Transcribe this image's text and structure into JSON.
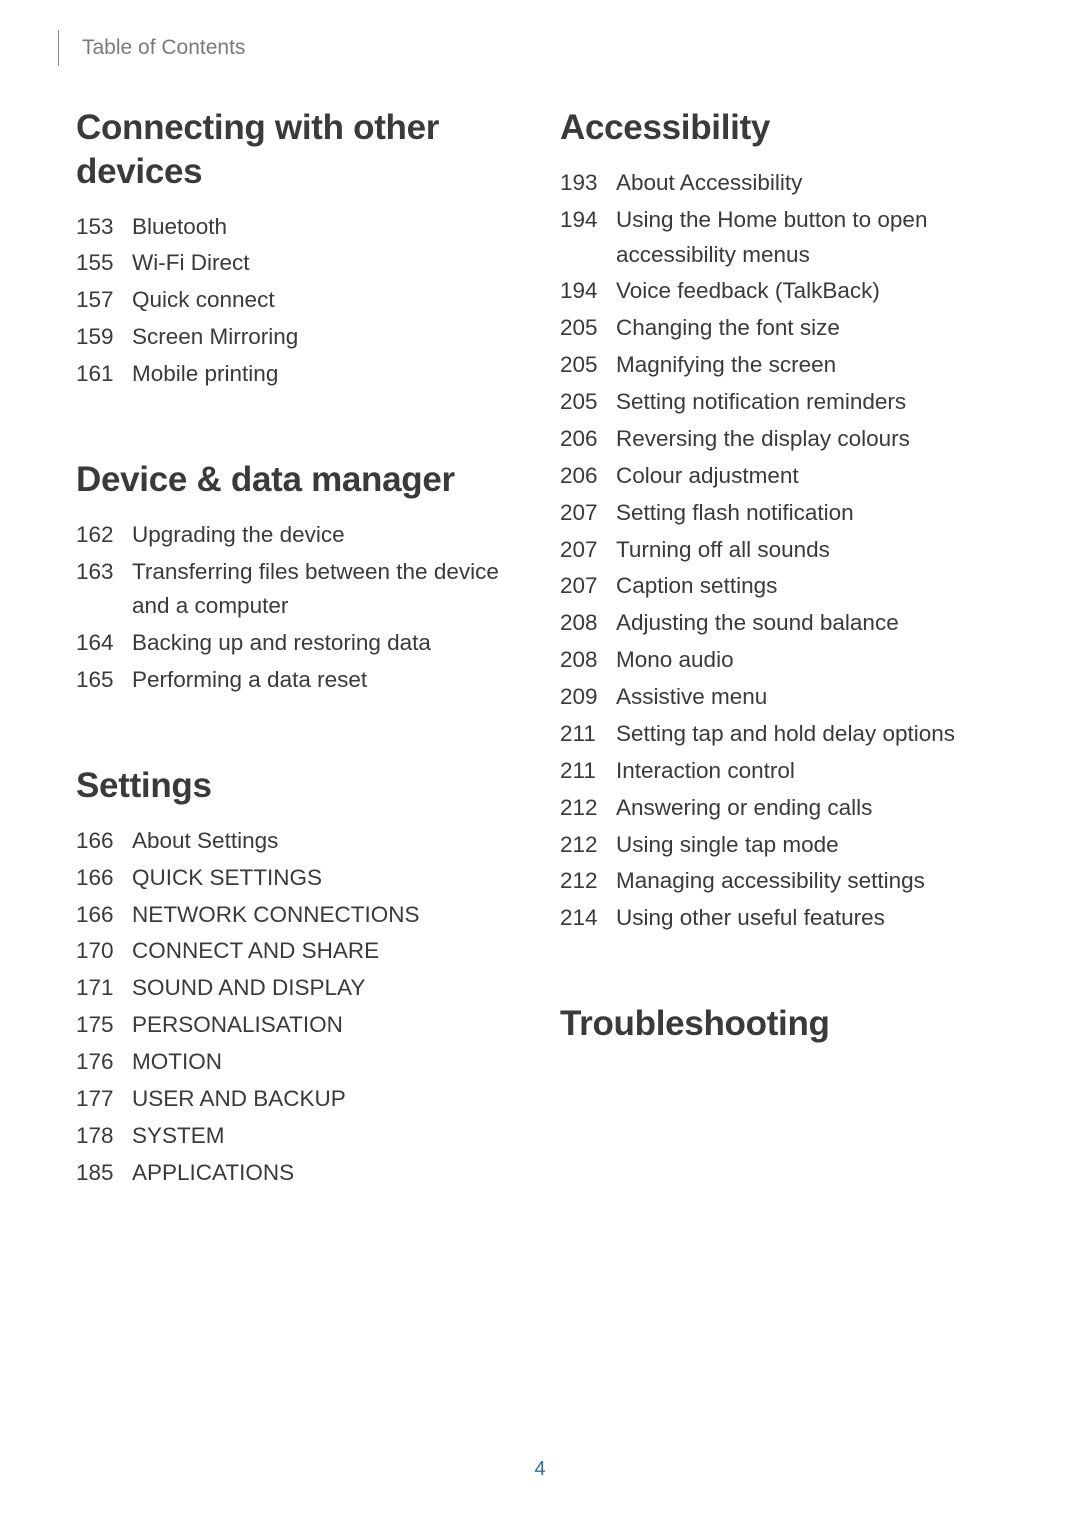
{
  "running_head": "Table of Contents",
  "page_number": "4",
  "left_column": [
    {
      "heading": "Connecting with other devices",
      "entries": [
        {
          "page": "153",
          "title": "Bluetooth"
        },
        {
          "page": "155",
          "title": "Wi-Fi Direct"
        },
        {
          "page": "157",
          "title": "Quick connect"
        },
        {
          "page": "159",
          "title": "Screen Mirroring"
        },
        {
          "page": "161",
          "title": "Mobile printing"
        }
      ]
    },
    {
      "heading": "Device & data manager",
      "entries": [
        {
          "page": "162",
          "title": "Upgrading the device"
        },
        {
          "page": "163",
          "title": "Transferring files between the device and a computer"
        },
        {
          "page": "164",
          "title": "Backing up and restoring data"
        },
        {
          "page": "165",
          "title": "Performing a data reset"
        }
      ]
    },
    {
      "heading": "Settings",
      "entries": [
        {
          "page": "166",
          "title": "About Settings"
        },
        {
          "page": "166",
          "title": "QUICK SETTINGS"
        },
        {
          "page": "166",
          "title": "NETWORK CONNECTIONS"
        },
        {
          "page": "170",
          "title": "CONNECT AND SHARE"
        },
        {
          "page": "171",
          "title": "SOUND AND DISPLAY"
        },
        {
          "page": "175",
          "title": "PERSONALISATION"
        },
        {
          "page": "176",
          "title": "MOTION"
        },
        {
          "page": "177",
          "title": "USER AND BACKUP"
        },
        {
          "page": "178",
          "title": "SYSTEM"
        },
        {
          "page": "185",
          "title": "APPLICATIONS"
        }
      ]
    }
  ],
  "right_column": [
    {
      "heading": "Accessibility",
      "entries": [
        {
          "page": "193",
          "title": "About Accessibility"
        },
        {
          "page": "194",
          "title": "Using the Home button to open accessibility menus"
        },
        {
          "page": "194",
          "title": "Voice feedback (TalkBack)"
        },
        {
          "page": "205",
          "title": "Changing the font size"
        },
        {
          "page": "205",
          "title": "Magnifying the screen"
        },
        {
          "page": "205",
          "title": "Setting notification reminders"
        },
        {
          "page": "206",
          "title": "Reversing the display colours"
        },
        {
          "page": "206",
          "title": "Colour adjustment"
        },
        {
          "page": "207",
          "title": "Setting flash notification"
        },
        {
          "page": "207",
          "title": "Turning off all sounds"
        },
        {
          "page": "207",
          "title": "Caption settings"
        },
        {
          "page": "208",
          "title": "Adjusting the sound balance"
        },
        {
          "page": "208",
          "title": "Mono audio"
        },
        {
          "page": "209",
          "title": "Assistive menu"
        },
        {
          "page": "211",
          "title": "Setting tap and hold delay options"
        },
        {
          "page": "211",
          "title": "Interaction control"
        },
        {
          "page": "212",
          "title": "Answering or ending calls"
        },
        {
          "page": "212",
          "title": "Using single tap mode"
        },
        {
          "page": "212",
          "title": "Managing accessibility settings"
        },
        {
          "page": "214",
          "title": "Using other useful features"
        }
      ]
    },
    {
      "heading": "Troubleshooting",
      "entries": []
    }
  ]
}
